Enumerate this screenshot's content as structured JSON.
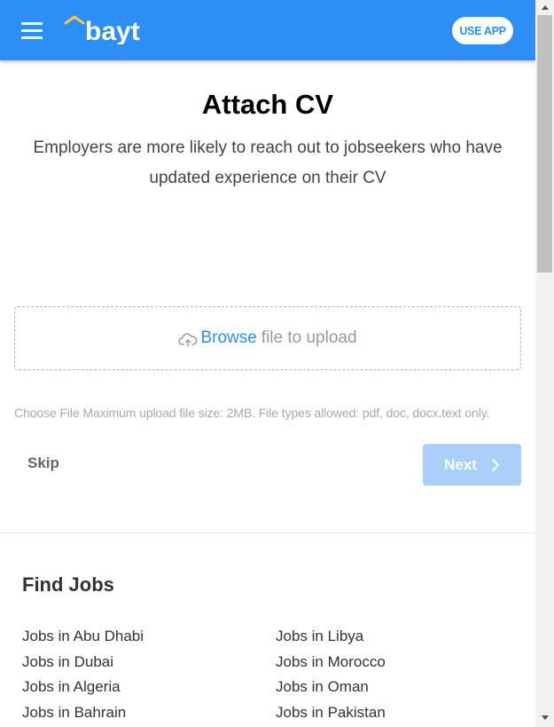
{
  "header": {
    "logo_text": "bayt",
    "use_app_label": "USE APP",
    "brand_color": "#2d8ef7",
    "logo_accent_color": "#f7c64a"
  },
  "attach": {
    "title": "Attach CV",
    "subtitle_line1": "Employers are more likely to reach out to jobseekers who have",
    "subtitle_line2": "updated experience on their CV",
    "upload_icon": "cloud-upload-icon",
    "browse_label": "Browse",
    "upload_rest": "file to upload",
    "hint": "Choose File Maximum upload file size: 2MB. File types allowed: pdf, doc, docx,text only."
  },
  "actions": {
    "skip_label": "Skip",
    "next_label": "Next",
    "next_icon": "chevron-right-icon"
  },
  "find_jobs": {
    "title": "Find Jobs",
    "left": [
      "Jobs in Abu Dhabi",
      "Jobs in Dubai",
      "Jobs in Algeria",
      "Jobs in Bahrain"
    ],
    "right": [
      "Jobs in Libya",
      "Jobs in Morocco",
      "Jobs in Oman",
      "Jobs in Pakistan"
    ]
  }
}
